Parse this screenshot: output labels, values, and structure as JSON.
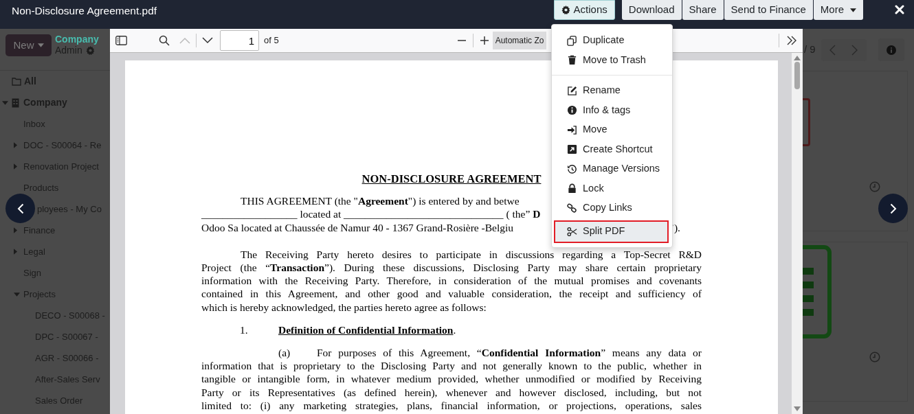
{
  "window": {
    "title": "Non-Disclosure Agreement.pdf"
  },
  "actions": [
    {
      "label": "Actions",
      "kind": "menu",
      "selected": true
    },
    {
      "label": "Download",
      "kind": "plain",
      "selected": false
    },
    {
      "label": "Share",
      "kind": "plain",
      "selected": false
    },
    {
      "label": "Send to Finance",
      "kind": "plain",
      "selected": false
    },
    {
      "label": "More",
      "kind": "dropdown",
      "selected": false
    }
  ],
  "sidebar": {
    "new_button": "New",
    "company": "Company",
    "user": "Admin",
    "tree": [
      {
        "label": "All",
        "kind": "all"
      },
      {
        "label": "Company",
        "kind": "company",
        "expanded": true,
        "children": [
          {
            "label": "Inbox"
          },
          {
            "label": "DOC - S00064 - Re",
            "expanded": false
          },
          {
            "label": "Renovation Project",
            "expanded": false
          },
          {
            "label": "Products"
          },
          {
            "label": "ployees - My Co"
          },
          {
            "label": "Finance",
            "expanded": false
          },
          {
            "label": "Legal",
            "expanded": false
          },
          {
            "label": "Sign"
          },
          {
            "label": "Projects",
            "expanded": true,
            "children": [
              {
                "label": "DECO - S00068 -"
              },
              {
                "label": "DPC - S00067 -"
              },
              {
                "label": "AGR - S00066 -"
              },
              {
                "label": "After-Sales Serv"
              },
              {
                "label": "Sales Order"
              }
            ]
          }
        ]
      }
    ]
  },
  "viewer": {
    "page": "1",
    "page_count": "of 5",
    "previous_disabled": true,
    "zoom": "Automatic Zo",
    "document": {
      "heading": "NON-DISCLOSURE AGREEMENT",
      "lines": [
        {
          "kind": "start_cut",
          "text": "THIS AGREEMENT (the \"**Agreement**\") is entered by and betwe"
        },
        {
          "kind": "cut",
          "text": "__________________ located at ______________________________ ( the” **D**"
        },
        {
          "kind": "cut",
          "text": "Odoo Sa located at Chaussée de Namur 40 - 1367 Grand-Rosière  -Belgiu",
          "tail": "’)."
        },
        {
          "kind": "start",
          "text": "The Receiving Party hereto desires to participate in discussions regarding a Top-Secret R&D"
        },
        {
          "kind": "full",
          "text": "Project (the “**Transaction**”).  During these discussions, Disclosing Party may share certain proprietary"
        },
        {
          "kind": "full",
          "text": "information with the Receiving Party.  Therefore, in consideration of the mutual promises and covenants"
        },
        {
          "kind": "full",
          "text": "contained in this Agreement, and other good and valuable consideration, the receipt and sufficiency of"
        },
        {
          "kind": "end",
          "text": "which is hereby acknowledged, the parties hereto agree as follows:"
        },
        {
          "kind": "section",
          "label": "1.",
          "text": "Definition of Confidential Information",
          "tail": "."
        },
        {
          "kind": "item",
          "label": "(a)",
          "text": "For purposes of this Agreement, “**Confidential Information**” means any data or"
        },
        {
          "kind": "full",
          "text": "information that is proprietary to the Disclosing Party and not generally known to the public, whether in"
        },
        {
          "kind": "full",
          "text": "tangible or intangible form, in whatever medium provided, whether unmodified or modified by Receiving"
        },
        {
          "kind": "full",
          "text": "Party or its Representatives (as defined herein), whenever and however disclosed, including, but not"
        },
        {
          "kind": "full",
          "text": "limited to: (i) any marketing strategies, plans, financial information, or projections, operations, sales"
        }
      ]
    }
  },
  "menu": {
    "groups": [
      {
        "items": [
          {
            "label": "Duplicate",
            "highlighted": false
          },
          {
            "label": "Move to Trash",
            "highlighted": false
          }
        ]
      },
      {
        "items": [
          {
            "label": "Rename",
            "highlighted": false
          },
          {
            "label": "Info & tags",
            "highlighted": false
          },
          {
            "label": "Move",
            "highlighted": false
          },
          {
            "label": "Create Shortcut",
            "highlighted": false
          },
          {
            "label": "Manage Versions",
            "highlighted": false
          },
          {
            "label": "Lock",
            "highlighted": false
          },
          {
            "label": "Copy Links",
            "highlighted": false
          },
          {
            "label": "Split PDF",
            "highlighted": true
          }
        ]
      }
    ]
  },
  "right_panel": {
    "pager": "/ 9"
  }
}
